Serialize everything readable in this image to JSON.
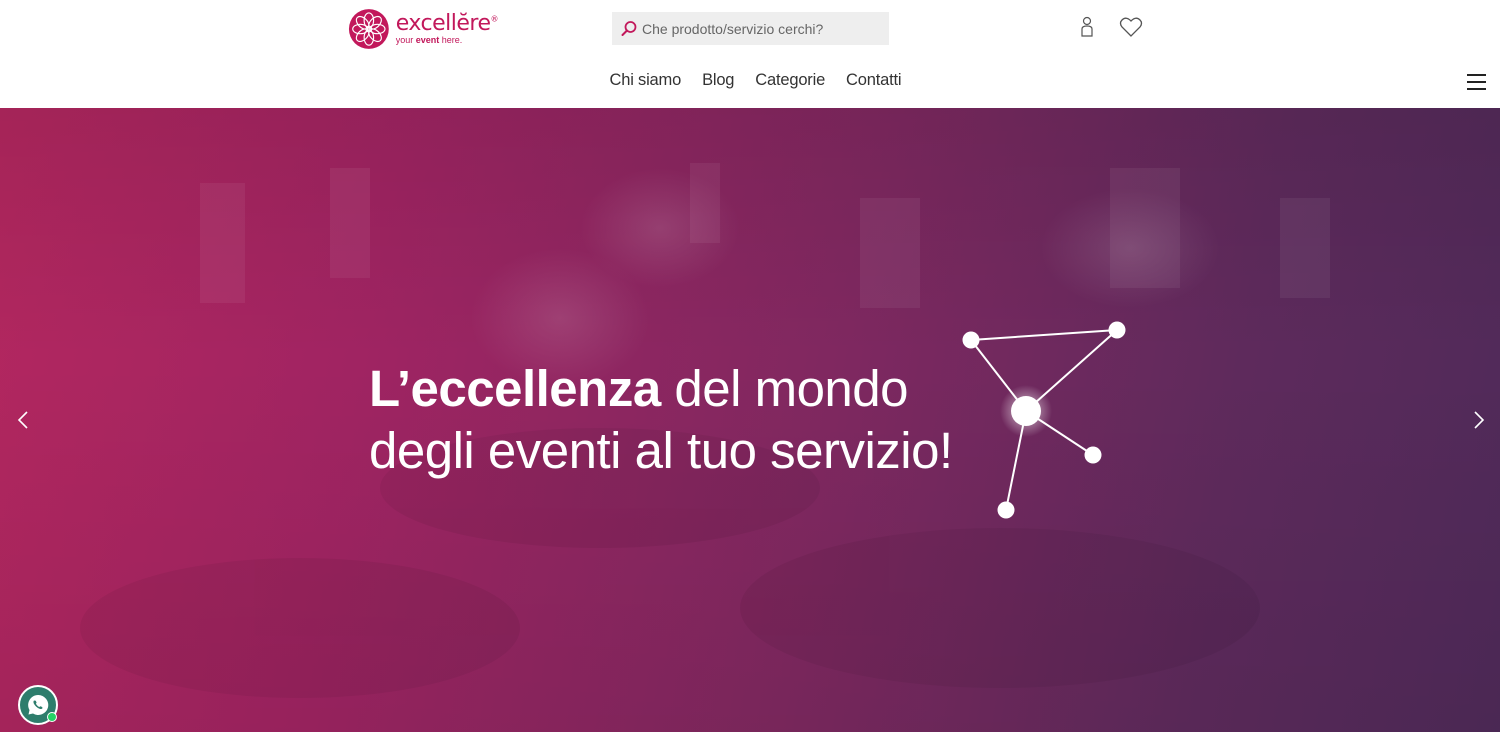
{
  "brand": {
    "name": "excellĕre",
    "registered": "®",
    "tagline_prefix": "your ",
    "tagline_bold": "event",
    "tagline_suffix": " here.",
    "color": "#c2185b"
  },
  "search": {
    "placeholder": "Che prodotto/servizio cerchi?",
    "value": ""
  },
  "header_icons": {
    "user": "user-icon",
    "wishlist": "heart-icon"
  },
  "nav": {
    "items": [
      {
        "label": "Chi siamo"
      },
      {
        "label": "Blog"
      },
      {
        "label": "Categorie"
      },
      {
        "label": "Contatti"
      }
    ],
    "menu_icon": "hamburger-menu-icon"
  },
  "hero": {
    "title_bold": "L’eccellenza",
    "title_line1_rest": " del mondo",
    "title_line2": "degli eventi al tuo servizio!",
    "gradient_start": "#b3275f",
    "gradient_end": "#4f2a59"
  },
  "carousel": {
    "prev_icon": "chevron-left-icon",
    "next_icon": "chevron-right-icon"
  },
  "chat": {
    "icon": "whatsapp-icon",
    "status_color": "#25d366"
  }
}
